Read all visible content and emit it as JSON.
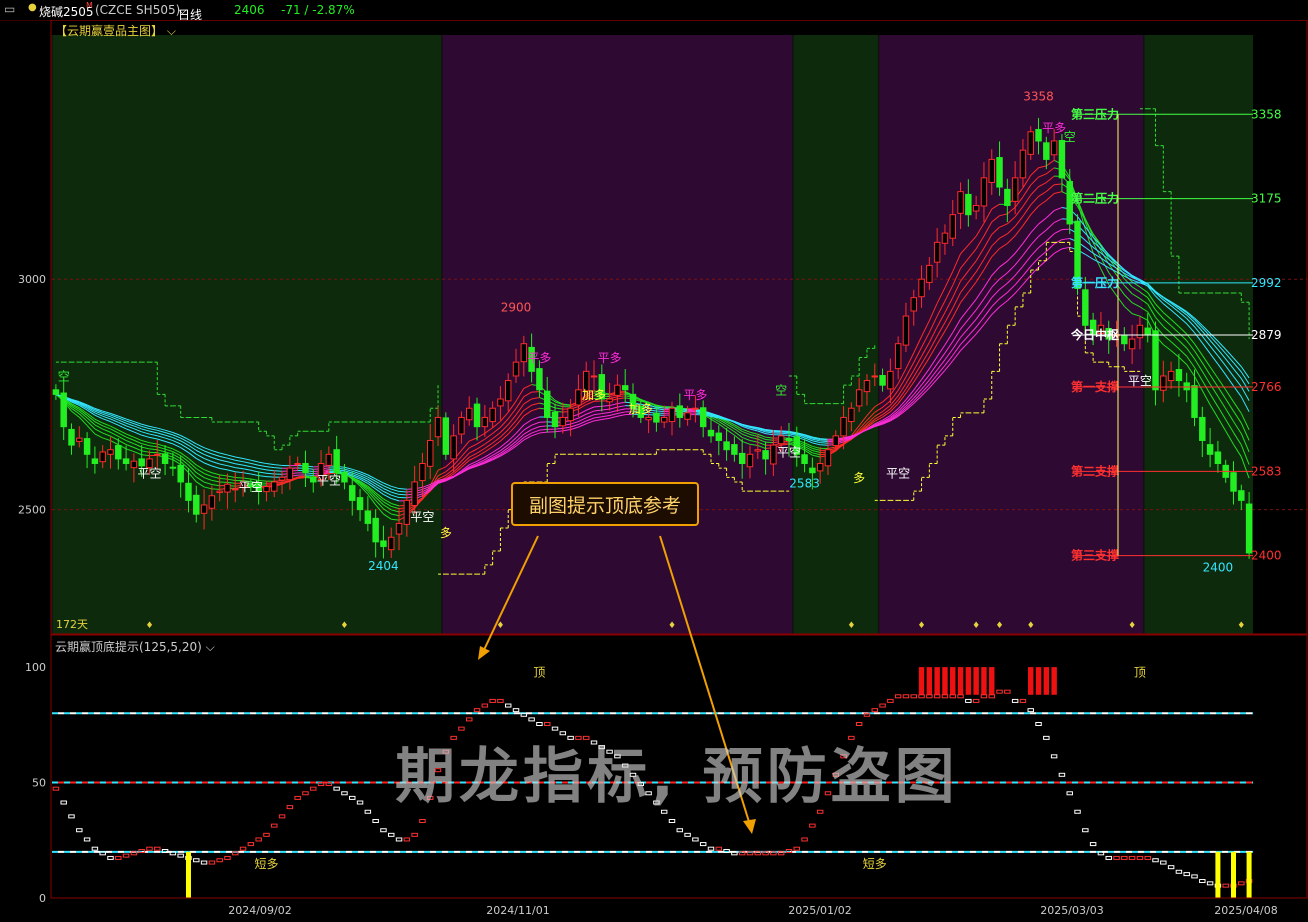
{
  "header": {
    "window_icon": "layout-icon",
    "symbol": "烧碱2505",
    "symbol_sup": "M",
    "code": "(CZCE SH505)",
    "period": "日线",
    "price": "2406",
    "change": "-71 / -2.87%"
  },
  "main_pane": {
    "title": "【云期赢壹品主图】"
  },
  "sub_pane": {
    "title": "云期赢顶底提示(125,5,20)"
  },
  "callout": {
    "text": "副图提示顶底参考"
  },
  "watermark": {
    "text": "期龙指标, 预防盗图"
  },
  "colors": {
    "up": "#ff2a2a",
    "down": "#22ee22",
    "cyan": "#33e6ff",
    "magenta": "#ff2dd8",
    "yellow": "#ffff00",
    "bull_bg": "#2e0a33",
    "bear_bg": "#0d2a0d"
  },
  "chart_data": [
    {
      "type": "candlestick",
      "ylim": [
        2230,
        3530
      ],
      "yticks": [
        "3000",
        "2500"
      ],
      "period_labels": [
        "2024/09/02",
        "2024/11/01",
        "2025/01/02",
        "2025/03/03",
        "2025/04/08"
      ],
      "bars_shown": 150,
      "days_label": "172天",
      "close": [
        2750,
        2680,
        2640,
        2655,
        2620,
        2600,
        2625,
        2630,
        2610,
        2600,
        2605,
        2595,
        2610,
        2620,
        2600,
        2590,
        2560,
        2520,
        2490,
        2510,
        2530,
        2540,
        2555,
        2545,
        2560,
        2550,
        2540,
        2550,
        2560,
        2570,
        2590,
        2600,
        2580,
        2560,
        2600,
        2620,
        2580,
        2560,
        2520,
        2500,
        2470,
        2430,
        2420,
        2440,
        2470,
        2520,
        2560,
        2600,
        2650,
        2700,
        2620,
        2660,
        2700,
        2720,
        2680,
        2700,
        2720,
        2740,
        2780,
        2820,
        2860,
        2800,
        2760,
        2700,
        2680,
        2700,
        2720,
        2760,
        2800,
        2790,
        2740,
        2740,
        2770,
        2760,
        2720,
        2700,
        2700,
        2690,
        2700,
        2720,
        2700,
        2710,
        2720,
        2680,
        2660,
        2650,
        2630,
        2620,
        2600,
        2620,
        2630,
        2610,
        2640,
        2660,
        2650,
        2620,
        2600,
        2580,
        2600,
        2630,
        2660,
        2700,
        2720,
        2760,
        2780,
        2790,
        2770,
        2800,
        2860,
        2920,
        2960,
        3000,
        3030,
        3080,
        3100,
        3140,
        3190,
        3140,
        3160,
        3220,
        3260,
        3200,
        3160,
        3220,
        3280,
        3320,
        3300,
        3260,
        3300,
        3220,
        3120,
        2980,
        2900,
        2880,
        2900,
        2870,
        2880,
        2860,
        2870,
        2900,
        2880,
        2760,
        2790,
        2800,
        2780,
        2760,
        2700,
        2650,
        2620,
        2600,
        2570,
        2540,
        2520,
        2406
      ],
      "price_labels": [
        {
          "text": "2900",
          "value": 2900,
          "index": 59
        },
        {
          "text": "3358",
          "value": 3358,
          "index": 126
        },
        {
          "text": "2404",
          "value": 2404,
          "index": 42
        },
        {
          "text": "2583",
          "value": 2583,
          "index": 96
        },
        {
          "text": "2400",
          "value": 2400,
          "index": 149
        }
      ],
      "signals": [
        {
          "text": "平空",
          "index": 12,
          "value": 2570
        },
        {
          "text": "平空",
          "index": 25,
          "value": 2540
        },
        {
          "text": "平空",
          "index": 35,
          "value": 2555
        },
        {
          "text": "平空",
          "index": 47,
          "value": 2475
        },
        {
          "text": "多",
          "index": 50,
          "value": 2440
        },
        {
          "text": "平多",
          "index": 62,
          "value": 2820
        },
        {
          "text": "加多",
          "index": 69,
          "value": 2740
        },
        {
          "text": "平多",
          "index": 71,
          "value": 2820
        },
        {
          "text": "加多",
          "index": 75,
          "value": 2710
        },
        {
          "text": "平多",
          "index": 82,
          "value": 2740
        },
        {
          "text": "空",
          "index": 93,
          "value": 2750
        },
        {
          "text": "平空",
          "index": 94,
          "value": 2615
        },
        {
          "text": "平空",
          "index": 108,
          "value": 2570
        },
        {
          "text": "多",
          "index": 103,
          "value": 2560
        },
        {
          "text": "平多",
          "index": 128,
          "value": 3320
        },
        {
          "text": "空",
          "index": 130,
          "value": 3300
        },
        {
          "text": "平空",
          "index": 139,
          "value": 2770
        },
        {
          "text": "平空",
          "index": 161,
          "value": 2520
        },
        {
          "text": "空",
          "index": 1,
          "value": 2780
        }
      ],
      "levels": [
        {
          "label": "第三压力",
          "value": 3358,
          "price": "3358",
          "color": "#44ff44"
        },
        {
          "label": "第二压力",
          "value": 3175,
          "price": "3175",
          "color": "#44ff44"
        },
        {
          "label": "第一压力",
          "value": 2992,
          "price": "2992",
          "color": "#33e6ff"
        },
        {
          "label": "今日中枢",
          "value": 2879,
          "price": "2879",
          "color": "#ffffff"
        },
        {
          "label": "第一支撑",
          "value": 2766,
          "price": "2766",
          "color": "#ff3030"
        },
        {
          "label": "第二支撑",
          "value": 2583,
          "price": "2583",
          "color": "#ff3030"
        },
        {
          "label": "第三支撑",
          "value": 2400,
          "price": "2400",
          "color": "#ff3030"
        }
      ],
      "regimes": [
        {
          "from": 0,
          "to": 50,
          "state": "bear"
        },
        {
          "from": 50,
          "to": 95,
          "state": "bull"
        },
        {
          "from": 95,
          "to": 106,
          "state": "bear"
        },
        {
          "from": 106,
          "to": 140,
          "state": "bull"
        },
        {
          "from": 140,
          "to": 180,
          "state": "bear"
        }
      ]
    },
    {
      "type": "oscillator",
      "ylim": [
        0,
        110
      ],
      "yticks": [
        "100",
        "50",
        "0"
      ],
      "lines": [
        80,
        50,
        20
      ],
      "labels": [
        {
          "text": "顶",
          "index": 62,
          "value": 96
        },
        {
          "text": "短多",
          "index": 27,
          "value": 13
        },
        {
          "text": "顶",
          "index": 139,
          "value": 96
        },
        {
          "text": "短多",
          "index": 105,
          "value": 13
        }
      ],
      "values": [
        48,
        42,
        36,
        30,
        26,
        22,
        20,
        18,
        18,
        19,
        20,
        21,
        22,
        22,
        21,
        20,
        19,
        18,
        17,
        16,
        16,
        17,
        18,
        20,
        22,
        24,
        26,
        28,
        32,
        36,
        40,
        44,
        46,
        48,
        50,
        50,
        48,
        46,
        44,
        42,
        38,
        34,
        30,
        28,
        26,
        26,
        28,
        34,
        44,
        56,
        64,
        70,
        74,
        78,
        82,
        84,
        86,
        86,
        84,
        82,
        80,
        78,
        76,
        76,
        74,
        72,
        70,
        70,
        70,
        68,
        66,
        64,
        62,
        58,
        54,
        50,
        46,
        42,
        38,
        34,
        30,
        28,
        26,
        24,
        22,
        22,
        21,
        20,
        20,
        20,
        20,
        20,
        20,
        20,
        21,
        22,
        26,
        32,
        38,
        46,
        54,
        62,
        70,
        76,
        80,
        82,
        84,
        86,
        88,
        88,
        88,
        88,
        88,
        88,
        88,
        88,
        88,
        86,
        86,
        88,
        88,
        90,
        90,
        86,
        86,
        82,
        76,
        70,
        62,
        54,
        46,
        38,
        30,
        24,
        20,
        18,
        18,
        18,
        18,
        18,
        18,
        17,
        16,
        14,
        12,
        11,
        10,
        8,
        7,
        6,
        6,
        6,
        7,
        8,
        8,
        8
      ],
      "red_blocks": [
        {
          "from": 111,
          "to": 120,
          "value": 100
        },
        {
          "from": 125,
          "to": 128,
          "value": 100
        }
      ],
      "yellow_bars": [
        17,
        149,
        151,
        153,
        156,
        158
      ]
    }
  ]
}
